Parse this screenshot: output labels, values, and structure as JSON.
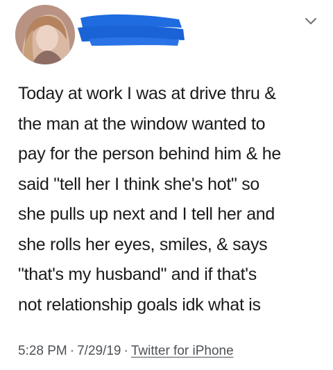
{
  "tweet": {
    "text": "Today at work I was at drive thru &\nthe man at the window wanted to\npay for the person behind him & he\nsaid \"tell her I think she's hot\" so\nshe pulls up next and I tell her and\nshe rolls her eyes, smiles, & says\n\"that's my husband\" and if that's\nnot relationship goals idk what is",
    "time": "5:28 PM",
    "date": "7/29/19",
    "separator": "·",
    "source": "Twitter for iPhone"
  },
  "header": {
    "avatar": "profile-photo",
    "name_redacted": true,
    "redaction_color": "#1f6be0",
    "menu_icon": "chevron-down-icon"
  }
}
